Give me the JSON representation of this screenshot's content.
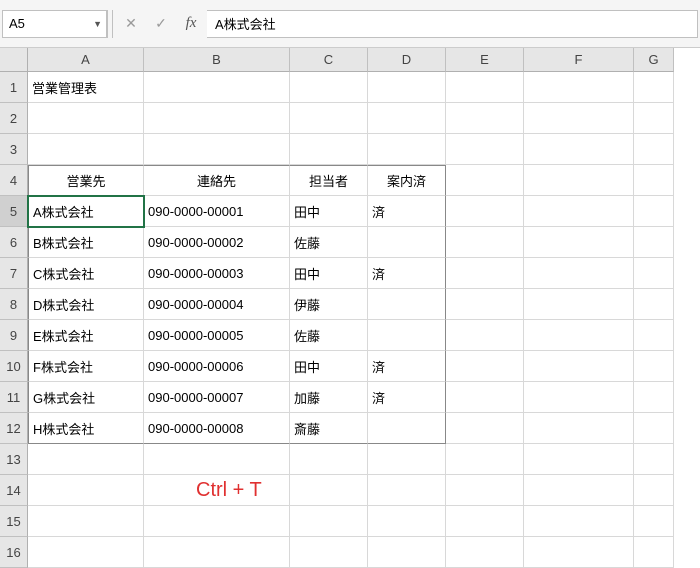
{
  "name_box": "A5",
  "formula_value": "A株式会社",
  "col_widths": {
    "A": 116,
    "B": 146,
    "C": 78,
    "D": 78,
    "E": 78,
    "F": 110,
    "G": 40
  },
  "columns": [
    "A",
    "B",
    "C",
    "D",
    "E",
    "F",
    "G"
  ],
  "row_heights": {
    "default": 31,
    "header": 24
  },
  "rows": [
    "1",
    "2",
    "3",
    "4",
    "5",
    "6",
    "7",
    "8",
    "9",
    "10",
    "11",
    "12",
    "13",
    "14",
    "15",
    "16"
  ],
  "active_cell": "A5",
  "cells": {
    "A1": "営業管理表",
    "A4": "営業先",
    "B4": "連絡先",
    "C4": "担当者",
    "D4": "案内済",
    "A5": "A株式会社",
    "B5": "090-0000-00001",
    "C5": "田中",
    "D5": "済",
    "A6": "B株式会社",
    "B6": "090-0000-00002",
    "C6": "佐藤",
    "D6": "",
    "A7": "C株式会社",
    "B7": "090-0000-00003",
    "C7": "田中",
    "D7": "済",
    "A8": "D株式会社",
    "B8": "090-0000-00004",
    "C8": "伊藤",
    "D8": "",
    "A9": "E株式会社",
    "B9": "090-0000-00005",
    "C9": "佐藤",
    "D9": "",
    "A10": "F株式会社",
    "B10": "090-0000-00006",
    "C10": "田中",
    "D10": "済",
    "A11": "G株式会社",
    "B11": "090-0000-00007",
    "C11": "加藤",
    "D11": "済",
    "A12": "H株式会社",
    "B12": "090-0000-00008",
    "C12": "斎藤",
    "D12": ""
  },
  "header_row_cells": [
    "A4",
    "B4",
    "C4",
    "D4"
  ],
  "data_range": {
    "cols": [
      "A",
      "B",
      "C",
      "D"
    ],
    "rows_from": 4,
    "rows_to": 12
  },
  "annotation": "Ctrl   +   T"
}
